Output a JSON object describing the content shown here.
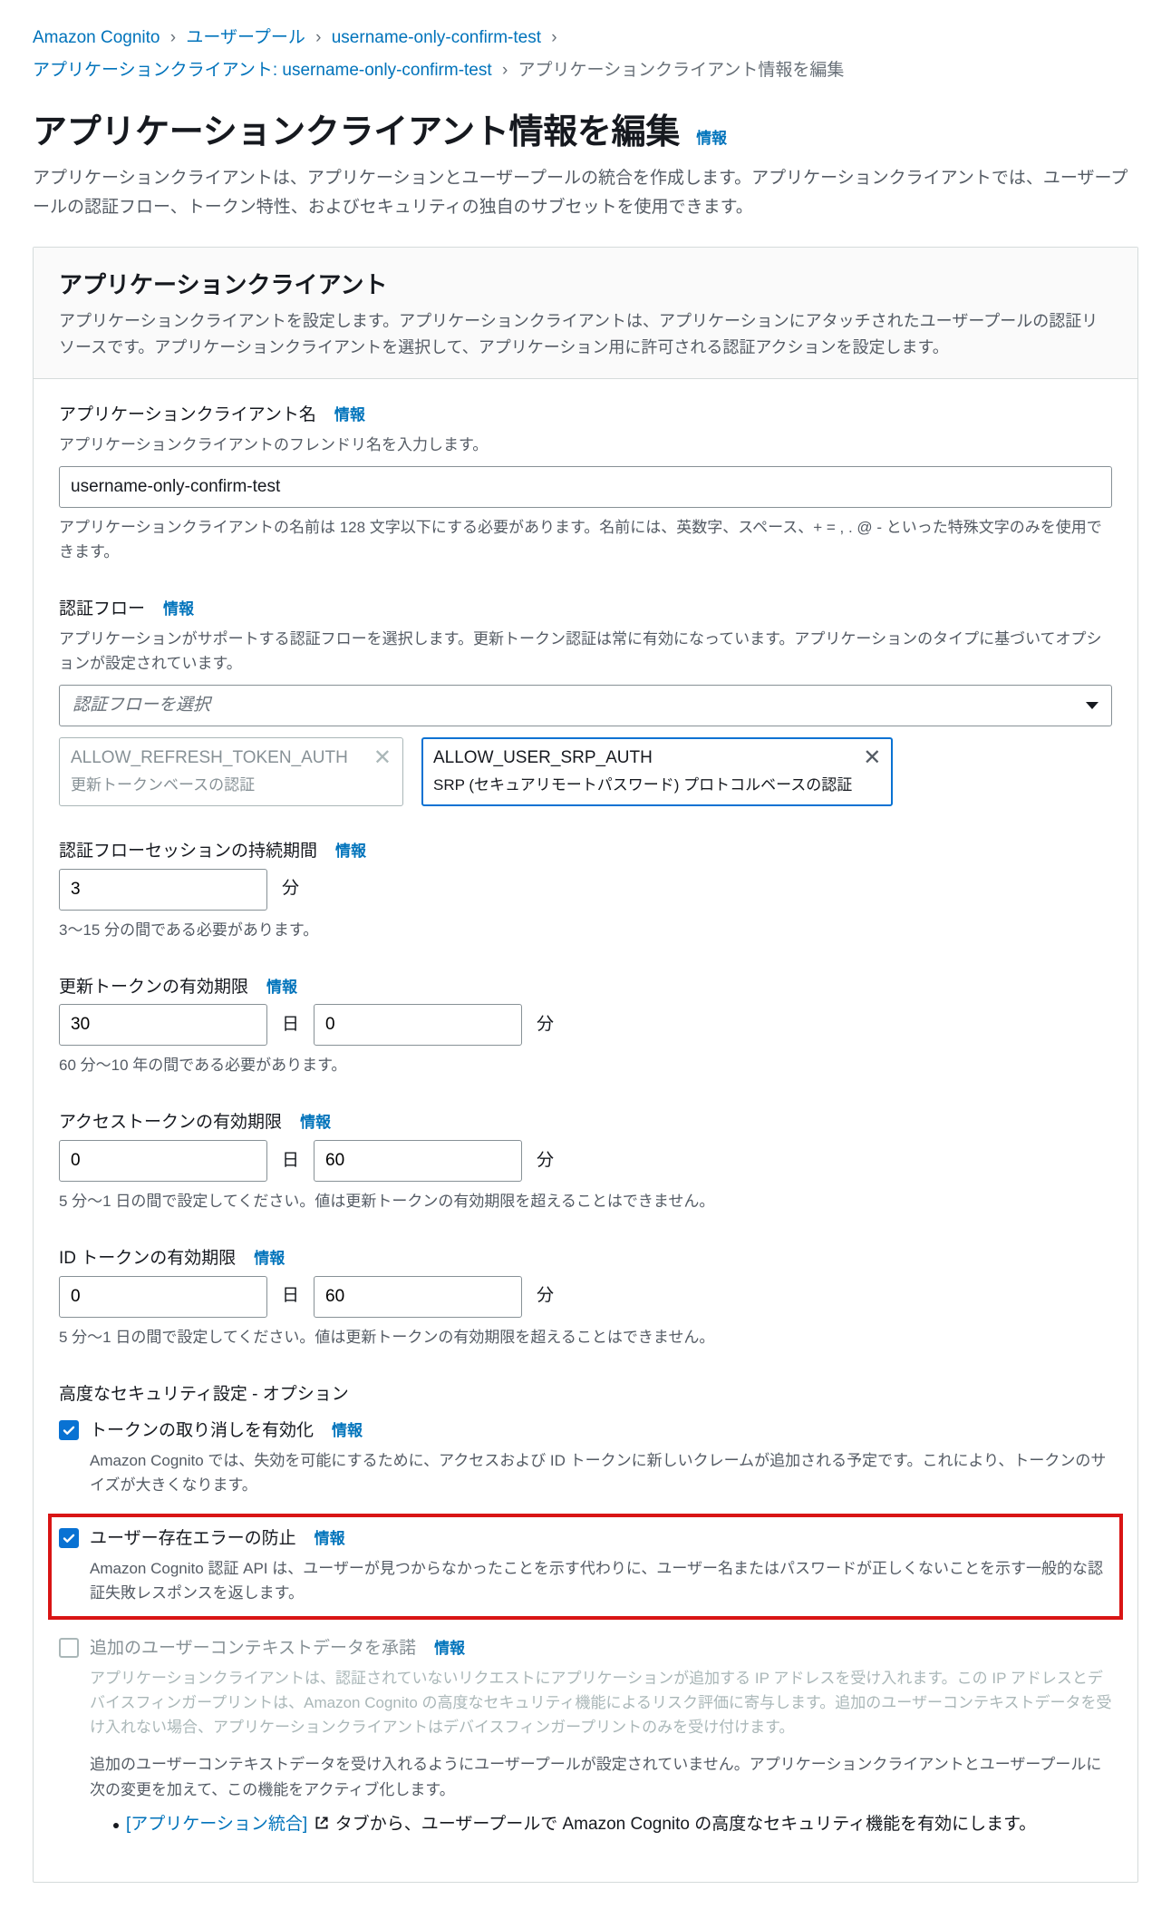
{
  "breadcrumb": {
    "items": [
      {
        "label": "Amazon Cognito"
      },
      {
        "label": "ユーザープール"
      },
      {
        "label": "username-only-confirm-test"
      },
      {
        "label": "アプリケーションクライアント: username-only-confirm-test"
      }
    ],
    "current": "アプリケーションクライアント情報を編集"
  },
  "page": {
    "title": "アプリケーションクライアント情報を編集",
    "info": "情報",
    "description": "アプリケーションクライアントは、アプリケーションとユーザープールの統合を作成します。アプリケーションクライアントでは、ユーザープールの認証フロー、トークン特性、およびセキュリティの独自のサブセットを使用できます。"
  },
  "panel": {
    "title": "アプリケーションクライアント",
    "desc": "アプリケーションクライアントを設定します。アプリケーションクライアントは、アプリケーションにアタッチされたユーザープールの認証リソースです。アプリケーションクライアントを選択して、アプリケーション用に許可される認証アクションを設定します。"
  },
  "fields": {
    "name": {
      "label": "アプリケーションクライアント名",
      "help": "アプリケーションクライアントのフレンドリ名を入力します。",
      "value": "username-only-confirm-test",
      "constraint": "アプリケーションクライアントの名前は 128 文字以下にする必要があります。名前には、英数字、スペース、+ = , . @ - といった特殊文字のみを使用できます。"
    },
    "authflow": {
      "label": "認証フロー",
      "help": "アプリケーションがサポートする認証フローを選択します。更新トークン認証は常に有効になっています。アプリケーションのタイプに基づいてオプションが設定されています。",
      "placeholder": "認証フローを選択",
      "chip_refresh_title": "ALLOW_REFRESH_TOKEN_AUTH",
      "chip_refresh_sub": "更新トークンベースの認証",
      "chip_srp_title": "ALLOW_USER_SRP_AUTH",
      "chip_srp_sub": "SRP (セキュアリモートパスワード) プロトコルベースの認証"
    },
    "session": {
      "label": "認証フローセッションの持続期間",
      "value": "3",
      "unit": "分",
      "constraint": "3〜15 分の間である必要があります。"
    },
    "refresh": {
      "label": "更新トークンの有効期限",
      "days": "30",
      "day_unit": "日",
      "mins": "0",
      "min_unit": "分",
      "constraint": "60 分〜10 年の間である必要があります。"
    },
    "access": {
      "label": "アクセストークンの有効期限",
      "days": "0",
      "day_unit": "日",
      "mins": "60",
      "min_unit": "分",
      "constraint": "5 分〜1 日の間で設定してください。値は更新トークンの有効期限を超えることはできません。"
    },
    "idtoken": {
      "label": "ID トークンの有効期限",
      "days": "0",
      "day_unit": "日",
      "mins": "60",
      "min_unit": "分",
      "constraint": "5 分〜1 日の間で設定してください。値は更新トークンの有効期限を超えることはできません。"
    }
  },
  "advanced": {
    "heading": "高度なセキュリティ設定 - オプション",
    "revoke": {
      "title": "トークンの取り消しを有効化",
      "desc": "Amazon Cognito では、失効を可能にするために、アクセスおよび ID トークンに新しいクレームが追加される予定です。これにより、トークンのサイズが大きくなります。"
    },
    "prevent": {
      "title": "ユーザー存在エラーの防止",
      "desc": "Amazon Cognito 認証 API は、ユーザーが見つからなかったことを示す代わりに、ユーザー名またはパスワードが正しくないことを示す一般的な認証失敗レスポンスを返します。"
    },
    "context": {
      "title": "追加のユーザーコンテキストデータを承諾",
      "desc": "アプリケーションクライアントは、認証されていないリクエストにアプリケーションが追加する IP アドレスを受け入れます。この IP アドレスとデバイスフィンガープリントは、Amazon Cognito の高度なセキュリティ機能によるリスク評価に寄与します。追加のユーザーコンテキストデータを受け入れない場合、アプリケーションクライアントはデバイスフィンガープリントのみを受け付けます。",
      "note": "追加のユーザーコンテキストデータを受け入れるようにユーザープールが設定されていません。アプリケーションクライアントとユーザープールに次の変更を加えて、この機能をアクティブ化します。",
      "bullet_link": "[アプリケーション統合]",
      "bullet_rest": " タブから、ユーザープールで Amazon Cognito の高度なセキュリティ機能を有効にします。"
    }
  },
  "info_label": "情報"
}
